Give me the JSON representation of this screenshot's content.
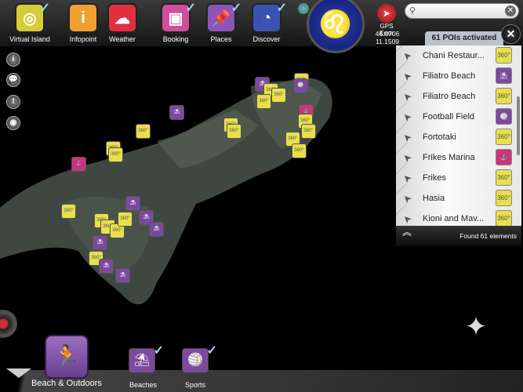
{
  "toolbar": {
    "items": [
      {
        "label": "Virtual Island",
        "icon": "virtual-island-icon",
        "color": "#d6cc3a",
        "checked": true,
        "glyph": "◎"
      },
      {
        "label": "Infopoint",
        "icon": "info-icon",
        "color": "#f0a030",
        "checked": false,
        "glyph": "i"
      },
      {
        "label": "Weather",
        "icon": "weather-icon",
        "color": "#e03040",
        "checked": false,
        "glyph": "☁"
      },
      {
        "label": "Booking",
        "icon": "booking-icon",
        "color": "#d04f98",
        "checked": true,
        "glyph": "▣"
      },
      {
        "label": "Places",
        "icon": "pushpin-icon",
        "color": "#8a55b5",
        "checked": true,
        "glyph": "📌"
      },
      {
        "label": "Discover",
        "icon": "discover-icon",
        "color": "#3b52b0",
        "checked": true,
        "glyph": "◔"
      }
    ],
    "check_glyph": "✓",
    "logo_glyph": "♌",
    "gps_label": "GPS Error",
    "gps_glyph": "➤",
    "lat": "46.0706",
    "lon": "11.1509"
  },
  "search": {
    "placeholder": "",
    "value": "",
    "icon": "⚲",
    "clear": "✕"
  },
  "poi_panel": {
    "activated": "61 POIs activated",
    "close": "✕",
    "nav_glyph": "➤",
    "found": "Found 61 elements",
    "collapse_glyph": "︽",
    "items": [
      {
        "name": "Chani Restaur...",
        "type": "360",
        "color": "#e8df4a"
      },
      {
        "name": "Filiatro Beach",
        "type": "beach",
        "color": "#7b4a9e"
      },
      {
        "name": "Filiatro Beach",
        "type": "360",
        "color": "#e8df4a"
      },
      {
        "name": "Football Field",
        "type": "sports",
        "color": "#7b4a9e"
      },
      {
        "name": "Fortotaki",
        "type": "360",
        "color": "#e8df4a"
      },
      {
        "name": "Frikes Marina",
        "type": "marina",
        "color": "#c8357a"
      },
      {
        "name": "Frikes",
        "type": "360",
        "color": "#e8df4a"
      },
      {
        "name": "Hasia",
        "type": "360",
        "color": "#e8df4a"
      },
      {
        "name": "Kioni and Mav...",
        "type": "360",
        "color": "#e8df4a"
      }
    ]
  },
  "side_buttons": [
    {
      "icon": "info-icon",
      "glyph": "i"
    },
    {
      "icon": "comment-icon",
      "glyph": "💬"
    },
    {
      "icon": "notice-icon",
      "glyph": "!"
    },
    {
      "icon": "camera-icon",
      "glyph": "◉"
    }
  ],
  "bottom": {
    "category": "Beach & Outdoors",
    "category_glyph": "🏃",
    "subs": [
      {
        "label": "Beaches",
        "glyph": "⛱",
        "checked": true
      },
      {
        "label": "Sports",
        "glyph": "🏐",
        "checked": true
      }
    ]
  },
  "marker_labels": {
    "360": "360°",
    "beach": "⛱",
    "sports": "🏐",
    "marina": "⚓"
  }
}
